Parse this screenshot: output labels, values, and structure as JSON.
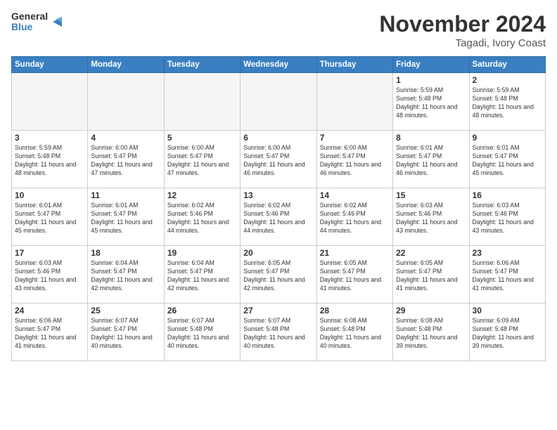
{
  "logo": {
    "line1": "General",
    "line2": "Blue"
  },
  "title": "November 2024",
  "location": "Tagadi, Ivory Coast",
  "days_header": [
    "Sunday",
    "Monday",
    "Tuesday",
    "Wednesday",
    "Thursday",
    "Friday",
    "Saturday"
  ],
  "weeks": [
    [
      {
        "day": "",
        "text": ""
      },
      {
        "day": "",
        "text": ""
      },
      {
        "day": "",
        "text": ""
      },
      {
        "day": "",
        "text": ""
      },
      {
        "day": "",
        "text": ""
      },
      {
        "day": "1",
        "text": "Sunrise: 5:59 AM\nSunset: 5:48 PM\nDaylight: 11 hours and 48 minutes."
      },
      {
        "day": "2",
        "text": "Sunrise: 5:59 AM\nSunset: 5:48 PM\nDaylight: 11 hours and 48 minutes."
      }
    ],
    [
      {
        "day": "3",
        "text": "Sunrise: 5:59 AM\nSunset: 5:48 PM\nDaylight: 11 hours and 48 minutes."
      },
      {
        "day": "4",
        "text": "Sunrise: 6:00 AM\nSunset: 5:47 PM\nDaylight: 11 hours and 47 minutes."
      },
      {
        "day": "5",
        "text": "Sunrise: 6:00 AM\nSunset: 5:47 PM\nDaylight: 11 hours and 47 minutes."
      },
      {
        "day": "6",
        "text": "Sunrise: 6:00 AM\nSunset: 5:47 PM\nDaylight: 11 hours and 46 minutes."
      },
      {
        "day": "7",
        "text": "Sunrise: 6:00 AM\nSunset: 5:47 PM\nDaylight: 11 hours and 46 minutes."
      },
      {
        "day": "8",
        "text": "Sunrise: 6:01 AM\nSunset: 5:47 PM\nDaylight: 11 hours and 46 minutes."
      },
      {
        "day": "9",
        "text": "Sunrise: 6:01 AM\nSunset: 5:47 PM\nDaylight: 11 hours and 45 minutes."
      }
    ],
    [
      {
        "day": "10",
        "text": "Sunrise: 6:01 AM\nSunset: 5:47 PM\nDaylight: 11 hours and 45 minutes."
      },
      {
        "day": "11",
        "text": "Sunrise: 6:01 AM\nSunset: 5:47 PM\nDaylight: 11 hours and 45 minutes."
      },
      {
        "day": "12",
        "text": "Sunrise: 6:02 AM\nSunset: 5:46 PM\nDaylight: 11 hours and 44 minutes."
      },
      {
        "day": "13",
        "text": "Sunrise: 6:02 AM\nSunset: 5:46 PM\nDaylight: 11 hours and 44 minutes."
      },
      {
        "day": "14",
        "text": "Sunrise: 6:02 AM\nSunset: 5:46 PM\nDaylight: 11 hours and 44 minutes."
      },
      {
        "day": "15",
        "text": "Sunrise: 6:03 AM\nSunset: 5:46 PM\nDaylight: 11 hours and 43 minutes."
      },
      {
        "day": "16",
        "text": "Sunrise: 6:03 AM\nSunset: 5:46 PM\nDaylight: 11 hours and 43 minutes."
      }
    ],
    [
      {
        "day": "17",
        "text": "Sunrise: 6:03 AM\nSunset: 5:46 PM\nDaylight: 11 hours and 43 minutes."
      },
      {
        "day": "18",
        "text": "Sunrise: 6:04 AM\nSunset: 5:47 PM\nDaylight: 11 hours and 42 minutes."
      },
      {
        "day": "19",
        "text": "Sunrise: 6:04 AM\nSunset: 5:47 PM\nDaylight: 11 hours and 42 minutes."
      },
      {
        "day": "20",
        "text": "Sunrise: 6:05 AM\nSunset: 5:47 PM\nDaylight: 11 hours and 42 minutes."
      },
      {
        "day": "21",
        "text": "Sunrise: 6:05 AM\nSunset: 5:47 PM\nDaylight: 11 hours and 41 minutes."
      },
      {
        "day": "22",
        "text": "Sunrise: 6:05 AM\nSunset: 5:47 PM\nDaylight: 11 hours and 41 minutes."
      },
      {
        "day": "23",
        "text": "Sunrise: 6:06 AM\nSunset: 5:47 PM\nDaylight: 11 hours and 41 minutes."
      }
    ],
    [
      {
        "day": "24",
        "text": "Sunrise: 6:06 AM\nSunset: 5:47 PM\nDaylight: 11 hours and 41 minutes."
      },
      {
        "day": "25",
        "text": "Sunrise: 6:07 AM\nSunset: 5:47 PM\nDaylight: 11 hours and 40 minutes."
      },
      {
        "day": "26",
        "text": "Sunrise: 6:07 AM\nSunset: 5:48 PM\nDaylight: 11 hours and 40 minutes."
      },
      {
        "day": "27",
        "text": "Sunrise: 6:07 AM\nSunset: 5:48 PM\nDaylight: 11 hours and 40 minutes."
      },
      {
        "day": "28",
        "text": "Sunrise: 6:08 AM\nSunset: 5:48 PM\nDaylight: 11 hours and 40 minutes."
      },
      {
        "day": "29",
        "text": "Sunrise: 6:08 AM\nSunset: 5:48 PM\nDaylight: 11 hours and 39 minutes."
      },
      {
        "day": "30",
        "text": "Sunrise: 6:09 AM\nSunset: 5:48 PM\nDaylight: 11 hours and 39 minutes."
      }
    ]
  ]
}
